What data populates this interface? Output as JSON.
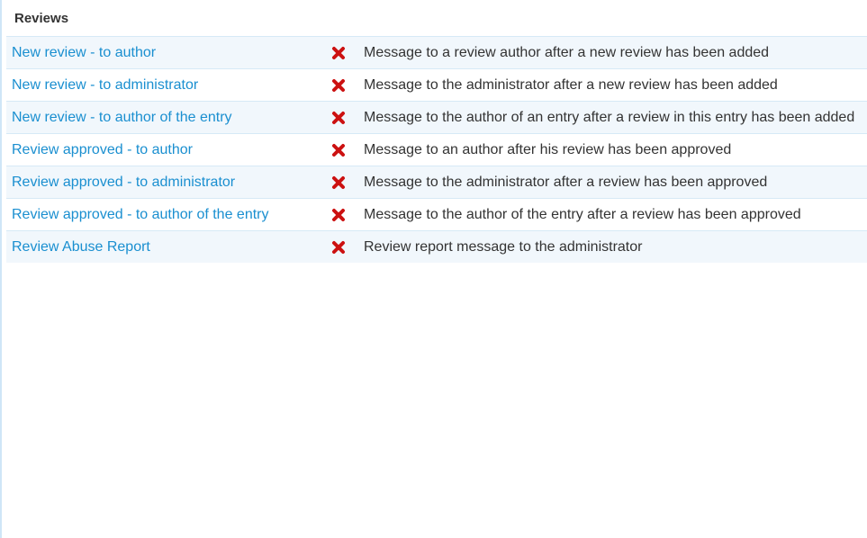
{
  "section": {
    "title": "Reviews"
  },
  "status_color": "#cc1111",
  "link_color": "#1a8fd0",
  "rows": [
    {
      "name": "New review - to author",
      "status": "disabled",
      "status_icon": "x-icon",
      "description": "Message to a review author after a new review has been added"
    },
    {
      "name": "New review - to administrator",
      "status": "disabled",
      "status_icon": "x-icon",
      "description": "Message to the administrator after a new review has been added"
    },
    {
      "name": "New review - to author of the entry",
      "status": "disabled",
      "status_icon": "x-icon",
      "description": "Message to the author of an entry after a review in this entry has been added"
    },
    {
      "name": "Review approved - to author",
      "status": "disabled",
      "status_icon": "x-icon",
      "description": "Message to an author after his review has been approved"
    },
    {
      "name": "Review approved - to administrator",
      "status": "disabled",
      "status_icon": "x-icon",
      "description": "Message to the administrator after a review has been approved"
    },
    {
      "name": "Review approved - to author of the entry",
      "status": "disabled",
      "status_icon": "x-icon",
      "description": "Message to the author of the entry after a review has been approved"
    },
    {
      "name": "Review Abuse Report",
      "status": "disabled",
      "status_icon": "x-icon",
      "description": "Review report message to the administrator"
    }
  ]
}
